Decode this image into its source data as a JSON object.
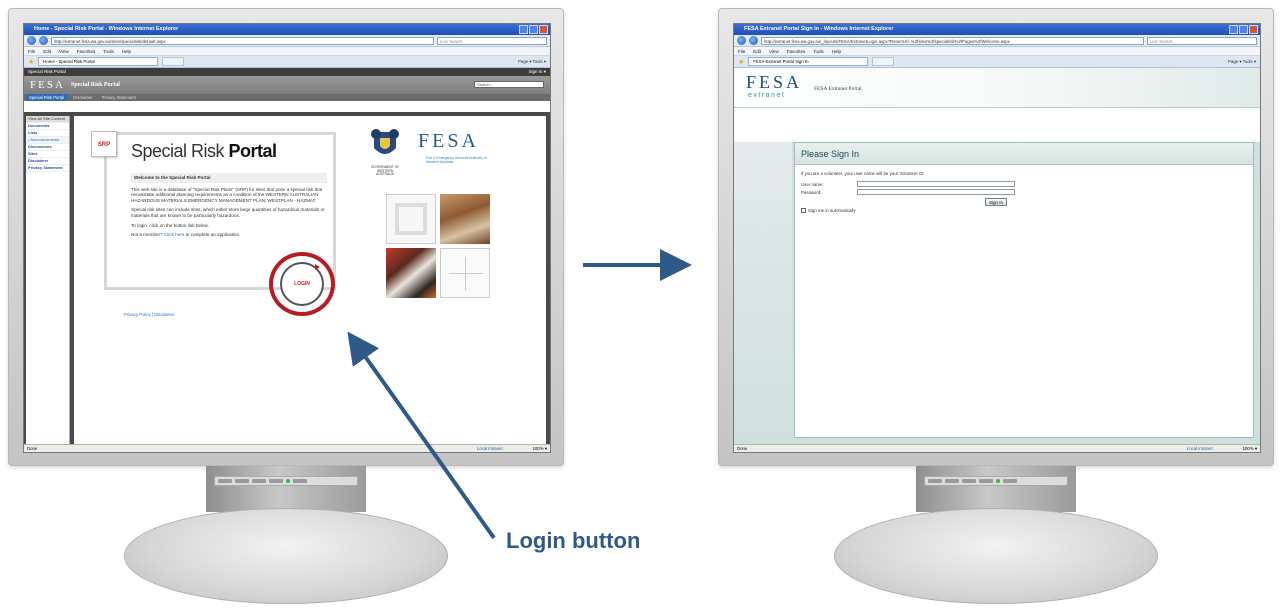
{
  "left_screen": {
    "window_title": "Home - Special Risk Portal - Windows Internet Explorer",
    "address": "http://extranet.fesa.wa.gov.au/sites/specialrisk/default.aspx",
    "search_placeholder": "Live Search",
    "menu": [
      "File",
      "Edit",
      "View",
      "Favorites",
      "Tools",
      "Help"
    ],
    "tab_label": "Home - Special Risk Portal",
    "toolbar_right": "Page ▾  Tools ▾",
    "site_top_left": "Special Risk Portal",
    "site_top_right": "Sign In ▾",
    "brand_fesa": "FESA",
    "brand_sub": "Special Risk Portal",
    "search_box": "Search...",
    "nav_tabs": [
      "Special Risk Portal",
      "Disclaimer",
      "Privacy Statement"
    ],
    "sidebar": {
      "header": "View All Site Content",
      "items": [
        "Documents",
        "Lists",
        "• Announcements",
        "Discussions",
        "Sites",
        "Disclaimer",
        "Privacy Statement"
      ]
    },
    "srp_badge": "SRP",
    "portal_title_light": "Special Risk ",
    "portal_title_bold": "Portal",
    "welcome": "Welcome to the Special Risk Portal",
    "para1": "This web site is a database of \"Special Risk Plans\" (SRP) for sites that pose a special risk that necessitate additional planning requirements as a condition of the WESTERN AUSTRALIAN HAZARDOUS MATERIALS EMERGENCY MANAGEMENT PLAN, WESTPLAN - HAZMAT.",
    "para2": "Special risk sites can include sites, which either store large quantities of hazardous materials or materials that are known to be particularly hazardous.",
    "para3": "To login, click on the button link below.",
    "para4_prefix": "Not a member? ",
    "para4_link": "Click here",
    "para4_suffix": " to complete an application.",
    "login_button": "LOGIN",
    "privacy_links": "Privacy Policy | Disclaimer",
    "crest_text": "GOVERNMENT OF WESTERN AUSTRALIA",
    "fesa_logo": "FESA",
    "fesa_logo_sub": "Fire & Emergency Services Authority of Western Australia",
    "status_left": "Done",
    "status_zone": "Local intranet",
    "status_zoom": "100% ▾"
  },
  "right_screen": {
    "window_title": "FESA Extranet Portal Sign In - Windows Internet Explorer",
    "address": "http://extranet.fesa.wa.gov.au/_layouts/FESA/ExtranetLogin.aspx?ReturnUrl=%2fsites%2fspecialrisk%2fPages%2fWelcome.aspx",
    "search_placeholder": "Live Search",
    "menu": [
      "File",
      "Edit",
      "View",
      "Favorites",
      "Tools",
      "Help"
    ],
    "tab_label": "FESA Extranet Portal Sign In",
    "toolbar_right": "Page ▾  Tools ▾",
    "logo": "FESA",
    "logo_sub": "extranet",
    "portal_name": "FESA Extranet Portal",
    "heading": "Please Sign In",
    "intro": "If you are a volunteer, your user name will be your Volunteer ID",
    "username_label": "User name:",
    "password_label": "Password:",
    "signin_button": "Sign In",
    "remember_label": "Sign me in automatically",
    "status_left": "Done",
    "status_zone": "Local intranet",
    "status_zoom": "100% ▾"
  },
  "annotation": {
    "callout": "Login button",
    "ring_color": "#b71c24",
    "arrow_color": "#2e5a8a"
  }
}
